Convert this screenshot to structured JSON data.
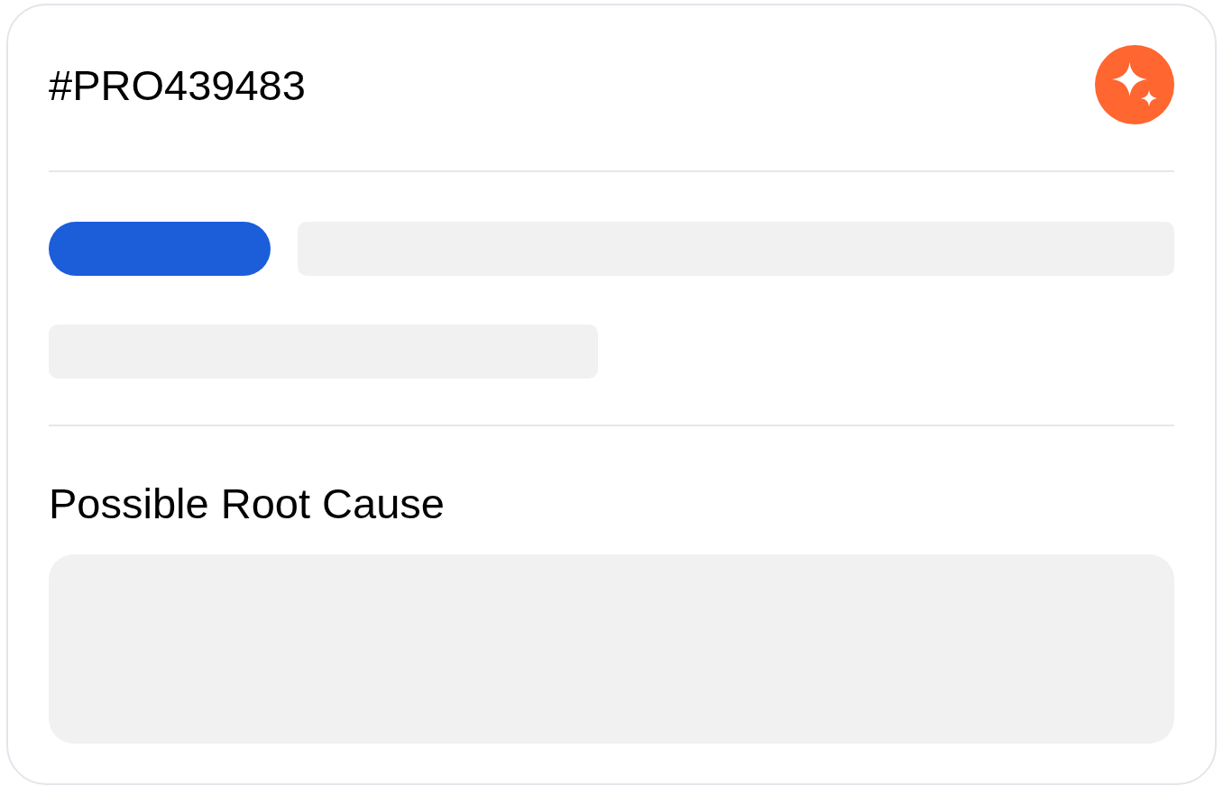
{
  "card": {
    "title": "#PRO439483",
    "loading": true,
    "section_title": "Possible Root Cause"
  }
}
